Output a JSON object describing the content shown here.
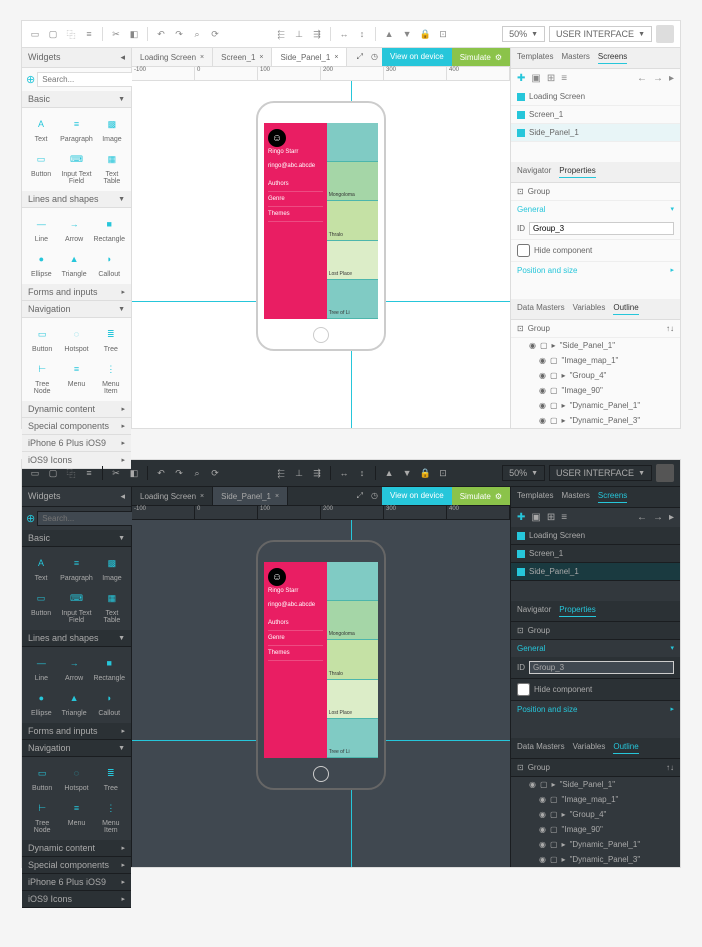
{
  "toolbar": {
    "zoom": "50%",
    "user_interface": "USER INTERFACE"
  },
  "widgets": {
    "title": "Widgets",
    "search_placeholder": "Search...",
    "cat_basic": "Basic",
    "items_basic": [
      "Text",
      "Paragraph",
      "Image",
      "Button",
      "Input Text Field",
      "Text Table"
    ],
    "cat_lines": "Lines and shapes",
    "items_lines": [
      "Line",
      "Arrow",
      "Rectangle",
      "Ellipse",
      "Triangle",
      "Callout"
    ],
    "cat_forms": "Forms and inputs",
    "cat_nav": "Navigation",
    "items_nav": [
      "Button",
      "Hotspot",
      "Tree",
      "Tree Node",
      "Menu",
      "Menu Item"
    ],
    "cat_dynamic": "Dynamic content",
    "cat_special": "Special components",
    "cat_iphone": "iPhone 6 Plus iOS9",
    "cat_ios9": "iOS9 Icons"
  },
  "tabs": {
    "loading": "Loading Screen",
    "screen1": "Screen_1",
    "side_panel": "Side_Panel_1",
    "view_device": "View on device",
    "simulate": "Simulate"
  },
  "panels": {
    "templates": "Templates",
    "masters": "Masters",
    "screens": "Screens",
    "screens_list": [
      "Loading Screen",
      "Screen_1",
      "Side_Panel_1"
    ],
    "navigator": "Navigator",
    "properties": "Properties",
    "group": "Group",
    "general": "General",
    "id_label": "ID",
    "id_value": "Group_3",
    "hide_component": "Hide component",
    "position_size": "Position and size",
    "data_masters": "Data Masters",
    "variables": "Variables",
    "outline": "Outline",
    "outline_items": [
      "\"Side_Panel_1\"",
      "\"Image_map_1\"",
      "\"Group_4\"",
      "\"Image_90\"",
      "\"Dynamic_Panel_1\"",
      "\"Dynamic_Panel_3\""
    ]
  },
  "mock": {
    "name": "Ringo Starr",
    "subtitle": "ringo@abc.abcde",
    "menu": [
      "Authors",
      "Genre",
      "Themes"
    ],
    "tiles": [
      "",
      "Mongoloma",
      "Thralo",
      "Lost Place",
      "Tree of Li"
    ]
  },
  "ruler": [
    "-100",
    "0",
    "100",
    "200",
    "300",
    "400"
  ]
}
